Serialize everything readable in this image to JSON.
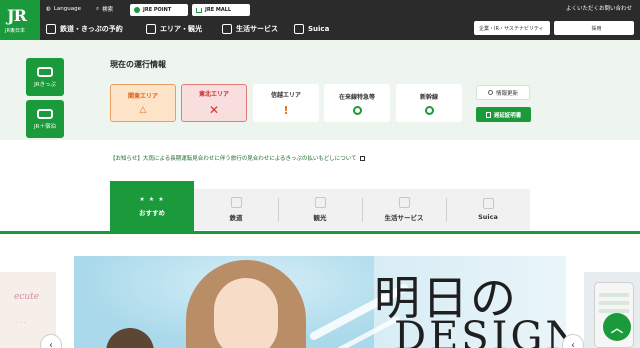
{
  "header": {
    "logo_text": "JR",
    "logo_sub": "JR東日本",
    "language_label": "Language",
    "search_label": "検索",
    "jre_point_label": "JRE POINT",
    "jre_mall_label": "JRE MALL",
    "faq_link": "よくいただくお問い合わせ",
    "company_box": "企業・IR・サステナビリティ",
    "recruit_box": "採用",
    "nav": [
      {
        "label": "鉄道・きっぷの予約",
        "icon": "train-icon"
      },
      {
        "label": "エリア・観光",
        "icon": "map-icon"
      },
      {
        "label": "生活サービス",
        "icon": "shop-icon"
      },
      {
        "label": "Suica",
        "icon": "card-icon"
      }
    ]
  },
  "side": {
    "tile1": "JRきっぷ",
    "tile2": "JR＋宿泊"
  },
  "status": {
    "title": "現在の運行情報",
    "cards": [
      {
        "label": "関東エリア",
        "symbol": "△"
      },
      {
        "label": "東北エリア",
        "symbol": "✕"
      },
      {
        "label": "信越エリア",
        "symbol": "!"
      },
      {
        "label": "在来線特急等",
        "symbol": "○"
      },
      {
        "label": "新幹線",
        "symbol": "○"
      }
    ],
    "update_button": "情報更新",
    "cert_button": "遅延証明書"
  },
  "notice": {
    "text": "【お知らせ】大雨による長期運転見合わせに伴う旅行の見合わせによるきっぷの払いもどしについて"
  },
  "tabs": {
    "active": "おすすめ",
    "items": [
      "鉄道",
      "観光",
      "生活サービス",
      "Suica"
    ]
  },
  "carousel": {
    "left_brand": "ecute",
    "hero_line1": "明日の",
    "hero_line2": "DESIGN",
    "prev_label": "‹",
    "next_label": "‹"
  },
  "colors": {
    "brand_green": "#1a9a3a",
    "header_dark": "#2b2b2b",
    "warn": "#e07020",
    "danger": "#d32f2f"
  }
}
